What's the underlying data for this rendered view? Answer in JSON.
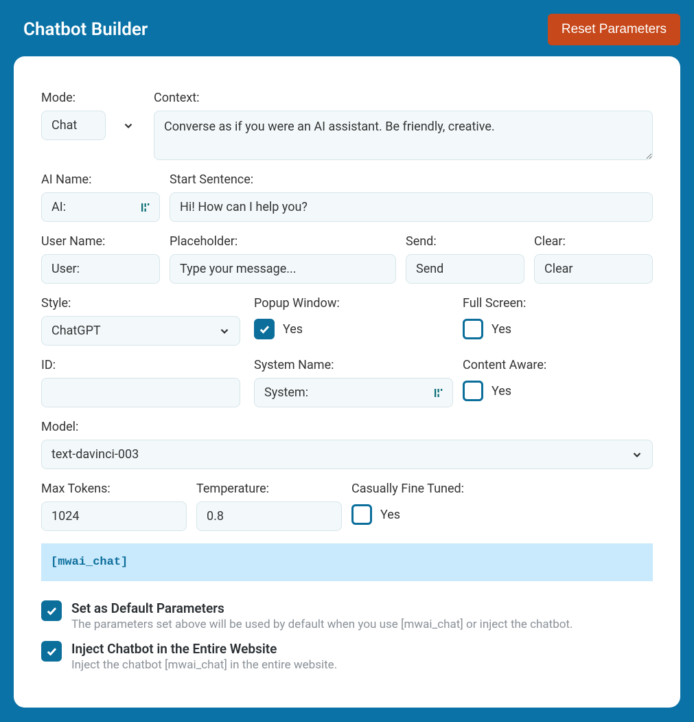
{
  "header": {
    "title": "Chatbot Builder",
    "reset_label": "Reset Parameters"
  },
  "labels": {
    "mode": "Mode:",
    "context": "Context:",
    "ai_name": "AI Name:",
    "start_sentence": "Start Sentence:",
    "user_name": "User Name:",
    "placeholder": "Placeholder:",
    "send": "Send:",
    "clear": "Clear:",
    "style": "Style:",
    "popup_window": "Popup Window:",
    "full_screen": "Full Screen:",
    "id": "ID:",
    "system_name": "System Name:",
    "content_aware": "Content Aware:",
    "model": "Model:",
    "max_tokens": "Max Tokens:",
    "temperature": "Temperature:",
    "casually_fine_tuned": "Casually Fine Tuned:"
  },
  "values": {
    "mode": "Chat",
    "context": "Converse as if you were an AI assistant. Be friendly, creative.",
    "ai_name": "AI:",
    "start_sentence": "Hi! How can I help you?",
    "user_name": "User:",
    "placeholder": "Type your message...",
    "send": "Send",
    "clear": "Clear",
    "style": "ChatGPT",
    "yes": "Yes",
    "id": "",
    "system_name": "System:",
    "model": "text-davinci-003",
    "max_tokens": "1024",
    "temperature": "0.8",
    "shortcode": "[mwai_chat]"
  },
  "options": {
    "default_params": {
      "title": "Set as Default Parameters",
      "desc": "The parameters set above will be used by default when you use [mwai_chat] or inject the chatbot."
    },
    "inject": {
      "title": "Inject Chatbot in the Entire Website",
      "desc": "Inject the chatbot [mwai_chat] in the entire website."
    }
  }
}
